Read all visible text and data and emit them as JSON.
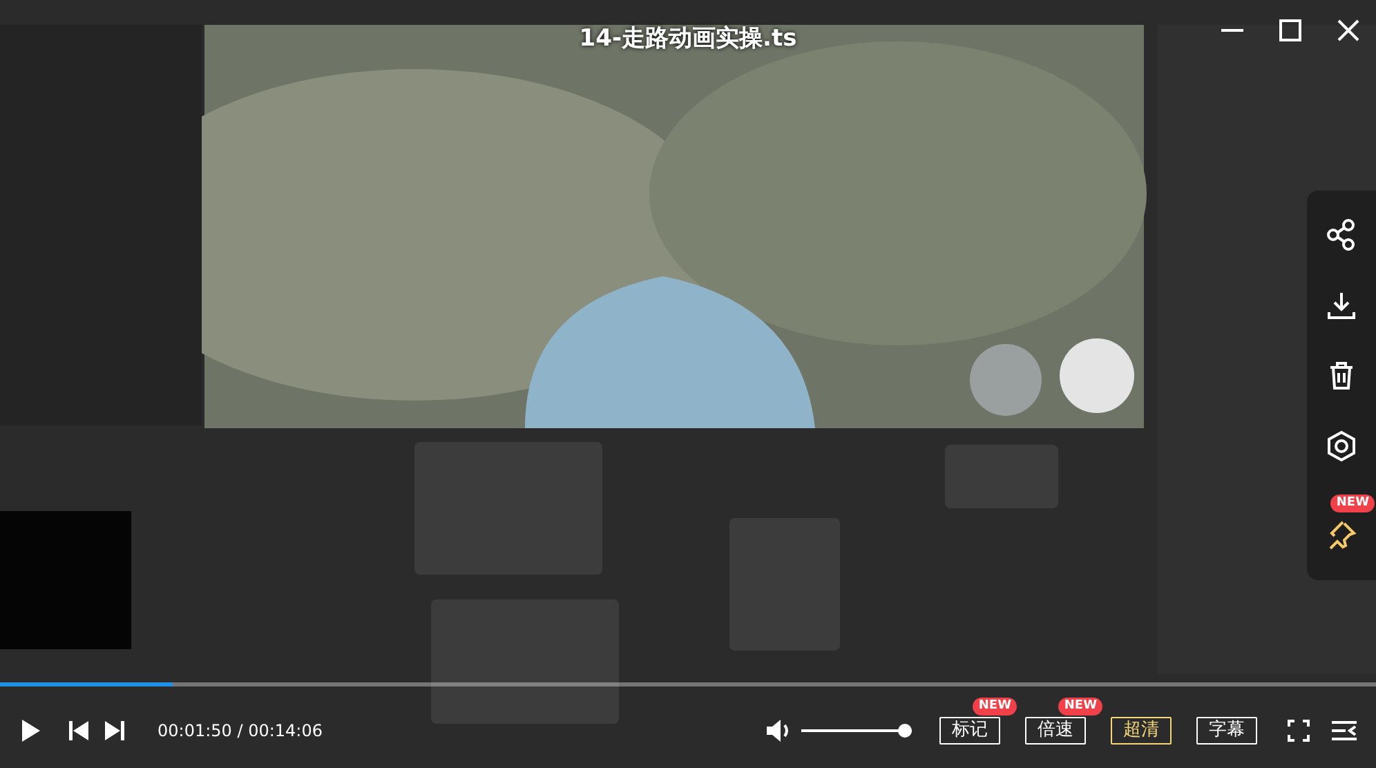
{
  "window": {
    "title": "14-走路动画实操.ts"
  },
  "progress": {
    "level": 0.126
  },
  "time": "00:01:50 / 00:14:06",
  "volume": {
    "level": 1.0
  },
  "buttons": [
    {
      "label": "标记",
      "badge": "NEW",
      "selected": false
    },
    {
      "label": "倍速",
      "badge": "NEW",
      "selected": false
    },
    {
      "label": "超清",
      "selected": true
    },
    {
      "label": "字幕",
      "selected": false
    }
  ],
  "side_panel": {
    "pin_badge": "NEW"
  }
}
